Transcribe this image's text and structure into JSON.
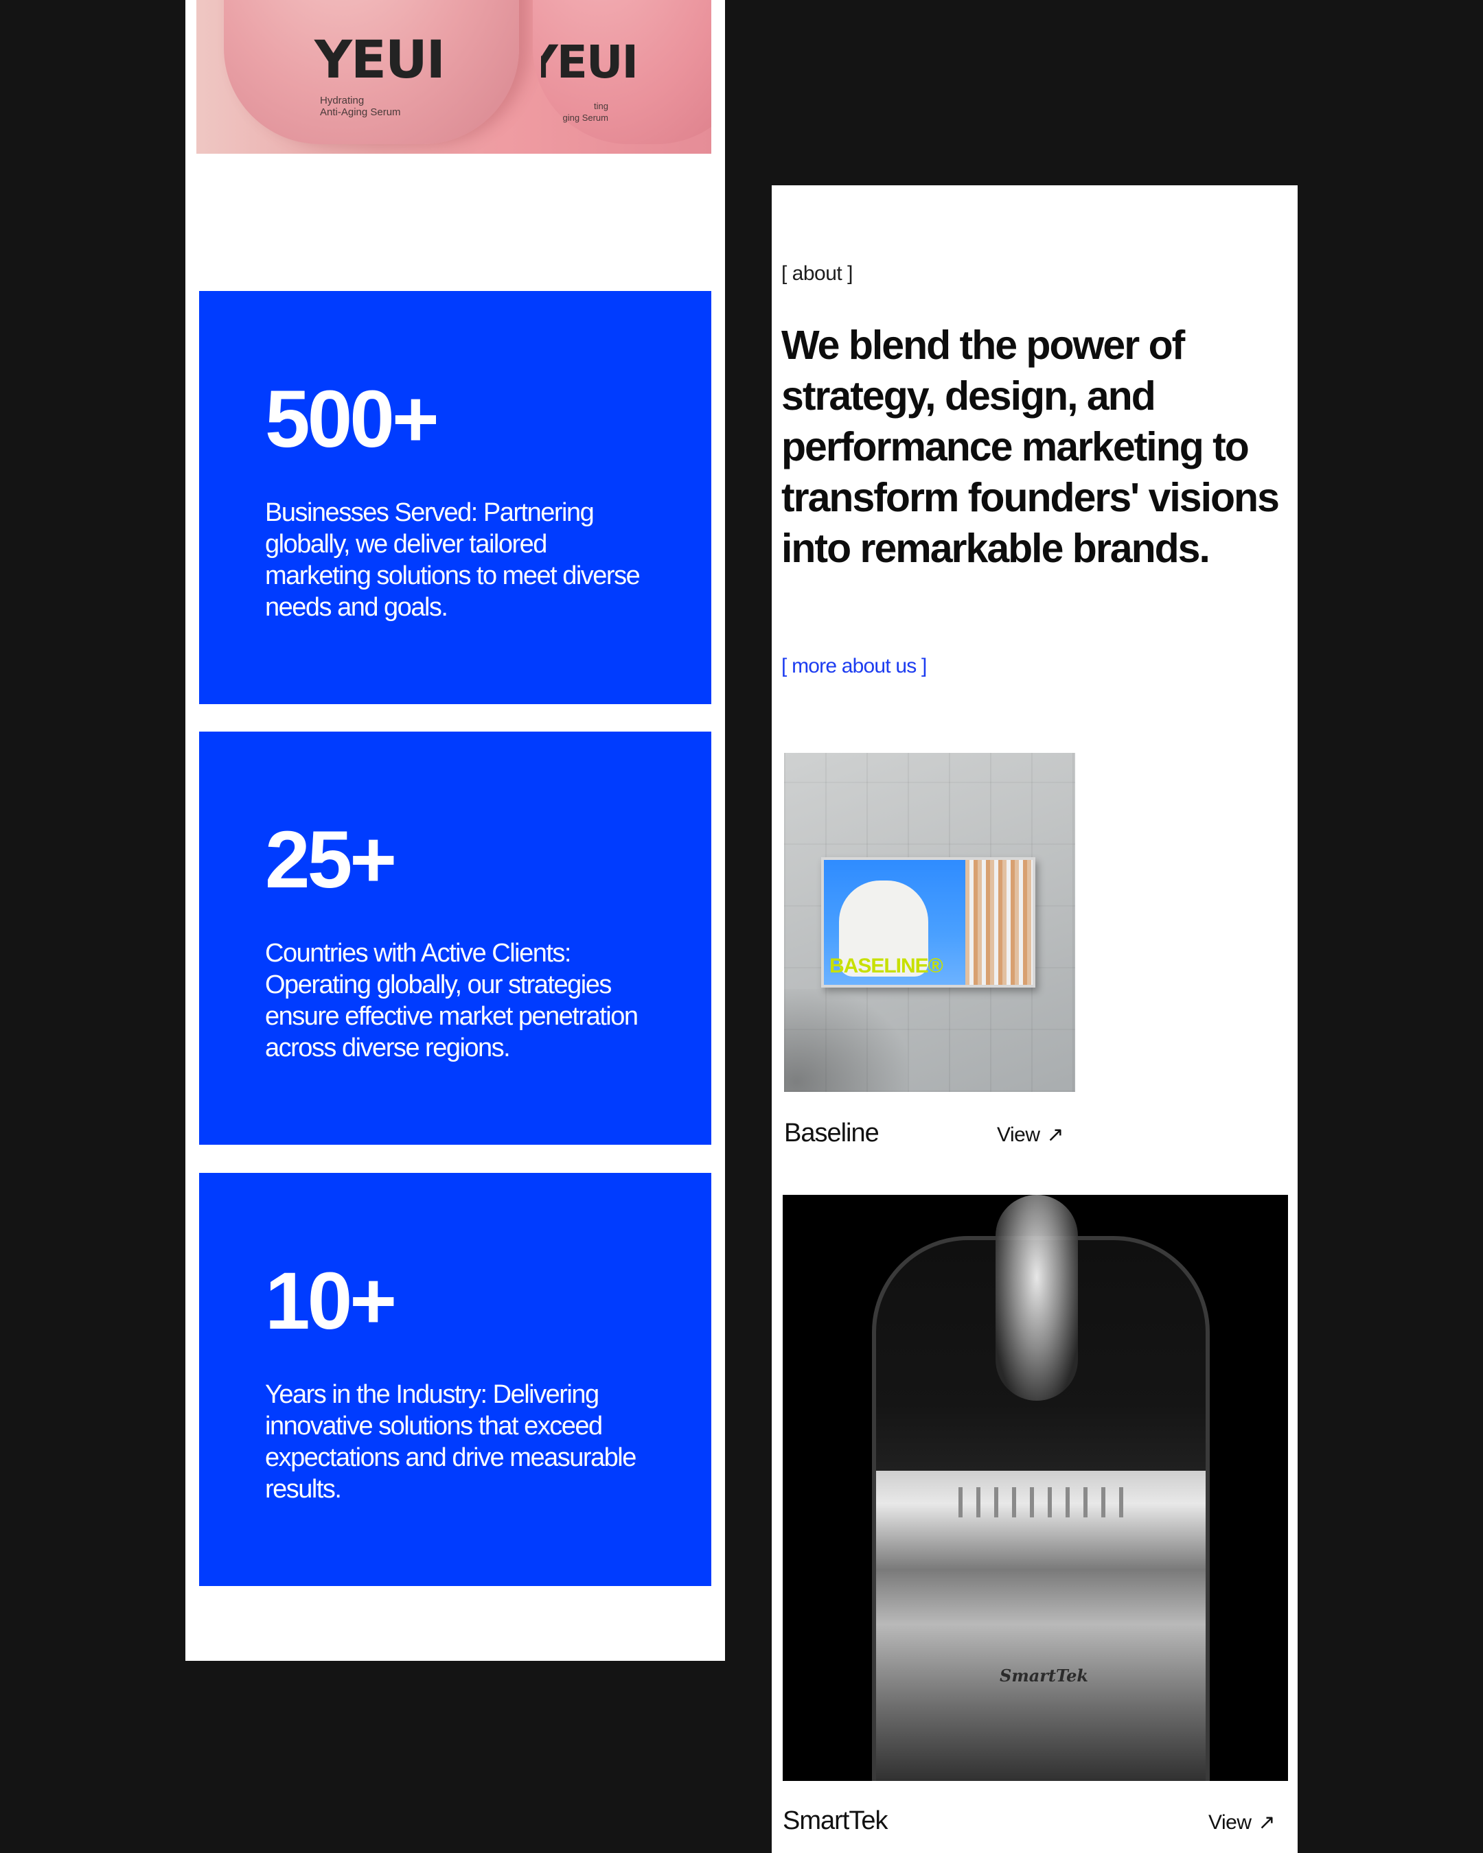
{
  "hero": {
    "brand_primary": "YEUI",
    "brand_secondary": "YEUI",
    "subtitle_line1": "Hydrating",
    "subtitle_line2": "Anti-Aging Serum",
    "subtitle_partial_line1": "ting",
    "subtitle_partial_line2": "ging Serum"
  },
  "stats": [
    {
      "value": "500+",
      "description": "Businesses Served: Partnering globally, we deliver tailored marketing solutions to meet diverse needs and goals."
    },
    {
      "value": "25+",
      "description": "Countries with Active Clients: Operating globally, our strategies ensure effective market penetration across diverse regions."
    },
    {
      "value": "10+",
      "description": "Years in the Industry: Delivering innovative solutions that exceed expectations and drive measurable results."
    }
  ],
  "about": {
    "tag": "[ about ]",
    "headline": "We blend the power of strategy, design, and performance marketing to transform founders' visions into remarkable brands.",
    "link_label": "[ more about us ]"
  },
  "projects": [
    {
      "name": "Baseline",
      "view_label": "View",
      "image_text": "BASELINE®"
    },
    {
      "name": "SmartTek",
      "view_label": "View",
      "image_text": "SmartTek"
    }
  ],
  "colors": {
    "background": "#141414",
    "accent_blue": "#003cff",
    "link_blue": "#1c3cf0",
    "panel": "#ffffff"
  },
  "icons": {
    "view_arrow": "arrow-up-right-icon"
  }
}
